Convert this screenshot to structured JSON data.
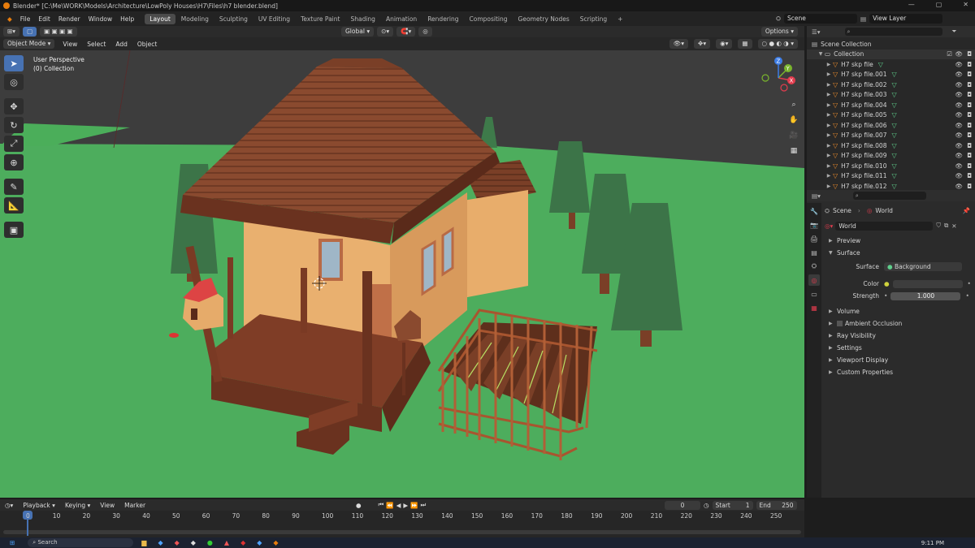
{
  "titlebar": {
    "title": "Blender* [C:\\Me\\WORK\\Models\\Architecture\\LowPoly Houses\\H7\\Files\\h7 blender.blend]",
    "min": "—",
    "max": "▢",
    "close": "✕"
  },
  "menus": [
    "File",
    "Edit",
    "Render",
    "Window",
    "Help"
  ],
  "workspaces": [
    "Layout",
    "Modeling",
    "Sculpting",
    "UV Editing",
    "Texture Paint",
    "Shading",
    "Animation",
    "Rendering",
    "Compositing",
    "Geometry Nodes",
    "Scripting"
  ],
  "active_workspace": "Layout",
  "scene": {
    "name": "Scene",
    "view_layer": "View Layer"
  },
  "viewport_header": {
    "transform": "Global",
    "options": "Options"
  },
  "viewport_header2": {
    "mode": "Object Mode",
    "view": "View",
    "select": "Select",
    "add": "Add",
    "object": "Object"
  },
  "viewport": {
    "perspective": "User Perspective",
    "collection": "(0) Collection"
  },
  "gizmo": {
    "x": "X",
    "y": "Y",
    "z": "Z"
  },
  "outliner": {
    "root": "Scene Collection",
    "collection": "Collection",
    "items": [
      "H7 skp file",
      "H7 skp file.001",
      "H7 skp file.002",
      "H7 skp file.003",
      "H7 skp file.004",
      "H7 skp file.005",
      "H7 skp file.006",
      "H7 skp file.007",
      "H7 skp file.008",
      "H7 skp file.009",
      "H7 skp file.010",
      "H7 skp file.011",
      "H7 skp file.012"
    ]
  },
  "properties": {
    "breadcrumb_scene": "Scene",
    "breadcrumb_world": "World",
    "world_name": "World",
    "sections": {
      "preview": "Preview",
      "surface": "Surface",
      "volume": "Volume",
      "ambient_occlusion": "Ambient Occlusion",
      "ray_visibility": "Ray Visibility",
      "settings": "Settings",
      "viewport_display": "Viewport Display",
      "custom_properties": "Custom Properties"
    },
    "surface_label": "Surface",
    "surface_value": "Background",
    "color_label": "Color",
    "strength_label": "Strength",
    "strength_value": "1.000"
  },
  "timeline": {
    "playback": "Playback",
    "keying": "Keying",
    "view": "View",
    "marker": "Marker",
    "current_frame": "0",
    "start_label": "Start",
    "start": "1",
    "end_label": "End",
    "end": "250",
    "ruler": [
      "0",
      "10",
      "20",
      "30",
      "40",
      "50",
      "60",
      "70",
      "80",
      "90",
      "100",
      "110",
      "120",
      "130",
      "140",
      "150",
      "160",
      "170",
      "180",
      "190",
      "200",
      "210",
      "220",
      "230",
      "240",
      "250"
    ]
  },
  "taskbar": {
    "search": "Search",
    "time": "9:11 PM"
  }
}
